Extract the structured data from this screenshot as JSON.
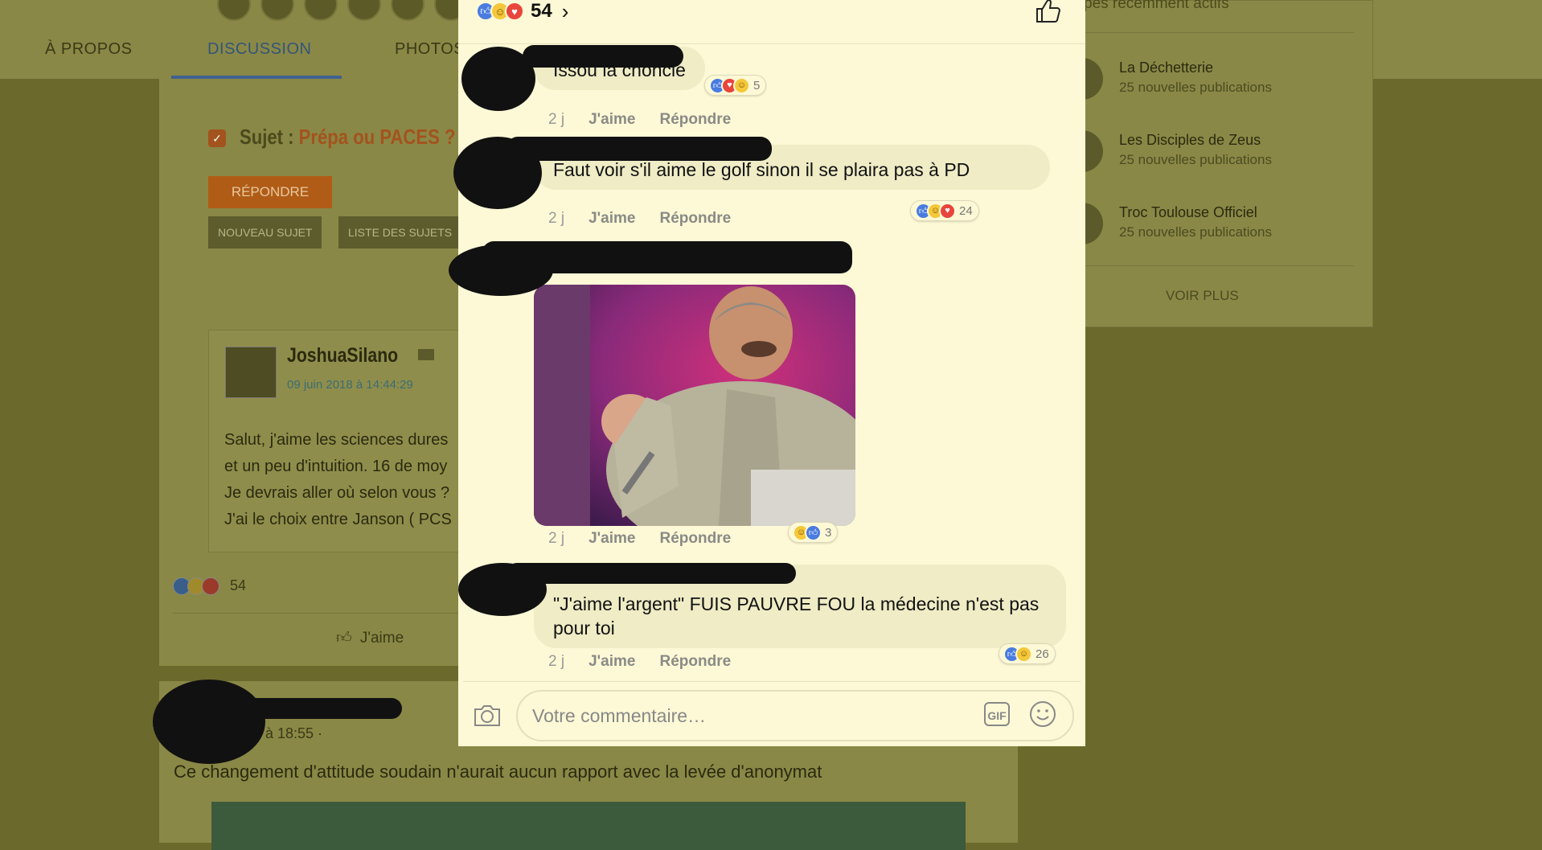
{
  "background": {
    "tabs": [
      "À PROPOS",
      "DISCUSSION",
      "PHOTOS"
    ],
    "subject_prefix": "Sujet : ",
    "subject_topic": "Prépa ou PACES ?",
    "reply_button": "RÉPONDRE",
    "new_topic_button": "NOUVEAU SUJET",
    "topic_list_button": "LISTE DES SUJETS",
    "post": {
      "author": "JoshuaSilano",
      "date": "09 juin 2018 à 14:44:29",
      "lines": [
        "Salut, j'aime les sciences dures",
        "et un peu d'intuition. 16 de moy",
        "Je devrais aller où selon vous ?",
        "J'ai le choix entre Janson ( PCS"
      ],
      "reaction_count": "54",
      "like_label": "J'aime"
    },
    "second_post": {
      "time": "à 18:55 ·",
      "text": "Ce changement d'attitude soudain n'aurait aucun rapport avec la levée d'anonymat"
    },
    "right_panel": {
      "header": "pes récemment actifs",
      "groups": [
        {
          "name": "La Déchetterie",
          "sub": "25 nouvelles publications"
        },
        {
          "name": "Les Disciples de Zeus",
          "sub": "25 nouvelles publications"
        },
        {
          "name": "Troc Toulouse Officiel",
          "sub": "25 nouvelles publications"
        }
      ],
      "see_more": "VOIR PLUS"
    }
  },
  "modal": {
    "reaction_total": "54",
    "comments": [
      {
        "text": "Issou la choncle",
        "time": "2 j",
        "like": "J'aime",
        "reply": "Répondre",
        "reactions": "5"
      },
      {
        "text": "Faut voir s'il aime le golf sinon il se plaira pas à PD",
        "time": "2 j",
        "like": "J'aime",
        "reply": "Répondre",
        "reactions": "24"
      },
      {
        "text": "",
        "time": "2 j",
        "like": "J'aime",
        "reply": "Répondre",
        "reactions": "3"
      },
      {
        "text": "\"J'aime l'argent\" FUIS PAUVRE FOU la médecine n'est pas pour toi",
        "time": "2 j",
        "like": "J'aime",
        "reply": "Répondre",
        "reactions": "26"
      }
    ],
    "composer": {
      "placeholder": "Votre commentaire…",
      "gif_label": "GIF"
    }
  },
  "colors": {
    "modal_bg": "#fdf9d6",
    "bubble_bg": "#efecc6",
    "like_blue": "#4a7ce0",
    "love_red": "#e8453c",
    "haha_yellow": "#f4c83a"
  }
}
